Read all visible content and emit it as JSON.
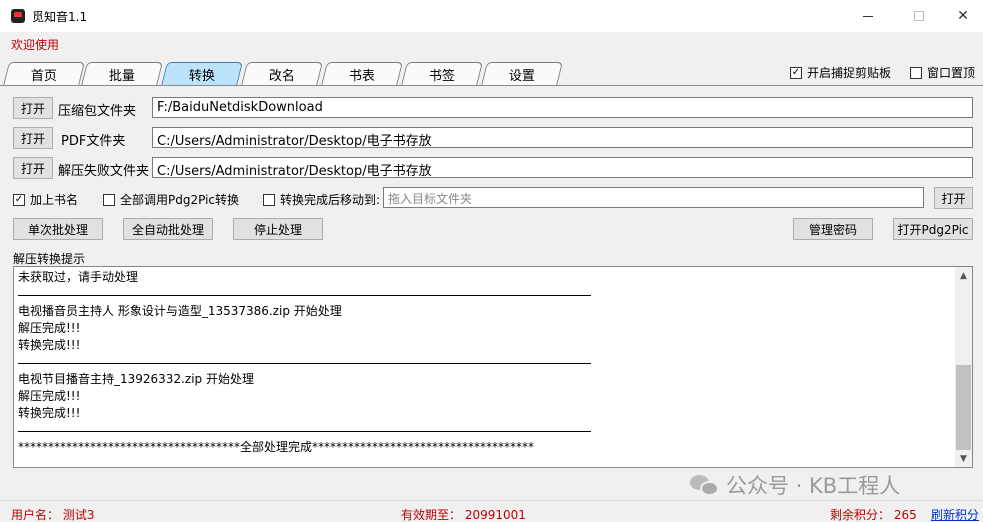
{
  "window": {
    "title": "觅知音1.1",
    "controls": [
      "minimize-icon",
      "maximize-icon",
      "close-icon"
    ]
  },
  "welcome": "欢迎使用",
  "tabs": [
    {
      "label": "首页",
      "active": false
    },
    {
      "label": "批量",
      "active": false
    },
    {
      "label": "转换",
      "active": true
    },
    {
      "label": "改名",
      "active": false
    },
    {
      "label": "书表",
      "active": false
    },
    {
      "label": "书签",
      "active": false
    },
    {
      "label": "设置",
      "active": false
    }
  ],
  "options": {
    "clipboard": {
      "label": "开启捕捉剪贴板",
      "checked": true
    },
    "topmost": {
      "label": "窗口置顶",
      "checked": false
    }
  },
  "folders": [
    {
      "button": "打开",
      "label": "压缩包文件夹",
      "value": "F:/BaiduNetdiskDownload"
    },
    {
      "button": "打开",
      "label": "PDF文件夹",
      "value": "C:/Users/Administrator/Desktop/电子书存放"
    },
    {
      "button": "打开",
      "label": "解压失败文件夹",
      "value": "C:/Users/Administrator/Desktop/电子书存放"
    }
  ],
  "checks": {
    "add_bookmark": {
      "label": "加上书名",
      "checked": true
    },
    "use_pdg2pic": {
      "label": "全部调用Pdg2Pic转换",
      "checked": false
    },
    "move_after": {
      "label": "转换完成后移动到:",
      "checked": false
    }
  },
  "move_target": {
    "placeholder": "拖入目标文件夹",
    "button": "打开"
  },
  "actions": {
    "single": "单次批处理",
    "auto": "全自动批处理",
    "stop": "停止处理",
    "password": "管理密码",
    "open_pdg2pic": "打开Pdg2Pic"
  },
  "log": {
    "label": "解压转换提示",
    "lines": [
      "未获取过，请手动处理",
      "---",
      "电视播音员主持人  形象设计与造型_13537386.zip   开始处理",
      "解压完成!!!",
      "转换完成!!!",
      "---",
      "电视节目播音主持_13926332.zip   开始处理",
      "解压完成!!!",
      "转换完成!!!",
      "---",
      "*************************************全部处理完成*************************************"
    ]
  },
  "status": {
    "user": "用户名：   测试3",
    "expiry": "有效期至：   20991001",
    "points": "剩余积分：   265",
    "refresh": "刷新积分"
  },
  "watermark": "公众号 · KB工程人"
}
